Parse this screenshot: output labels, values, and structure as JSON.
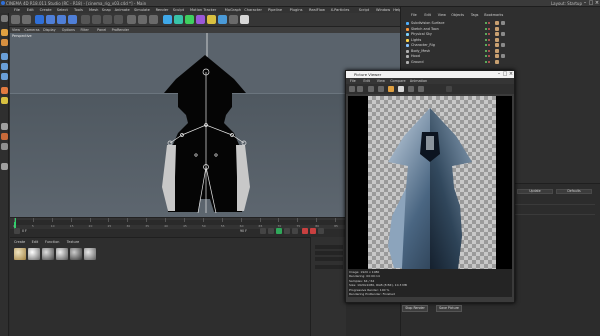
{
  "window": {
    "title": "CINEMA 4D R18.011 Studio (RC - R18) - [cinema_rig_v03.c4d *] - Main",
    "right_text": "Layout: Startup",
    "controls": [
      "–",
      "□",
      "×"
    ]
  },
  "menubar": {
    "items": [
      "File",
      "Edit",
      "Create",
      "Select",
      "Tools",
      "Mesh",
      "Snap",
      "Animate",
      "Simulate",
      "Render",
      "Sculpt",
      "Motion Tracker",
      "MoGraph",
      "Character",
      "Pipeline",
      "Plugins",
      "RealFlow",
      "X-Particles",
      "Script",
      "Window",
      "Help"
    ]
  },
  "viewport": {
    "menu": [
      "View",
      "Cameras",
      "Display",
      "Options",
      "Filter",
      "Panel",
      "ProRender"
    ],
    "label": "Perspective"
  },
  "timeline": {
    "frames": [
      "0",
      "5",
      "10",
      "15",
      "20",
      "25",
      "30",
      "35",
      "40",
      "45",
      "50",
      "55",
      "60",
      "65",
      "70",
      "75",
      "80",
      "85",
      "90"
    ],
    "current_frame": "0 F",
    "end_frame": "90 F"
  },
  "materials": {
    "menu": [
      "Create",
      "Edit",
      "Function",
      "Texture"
    ],
    "count": 6
  },
  "objects": {
    "menu": [
      "File",
      "Edit",
      "View",
      "Objects",
      "Tags",
      "Bookmarks"
    ],
    "rows": [
      {
        "name": "Subdivision Surface",
        "icon_color": "#4fb0ff"
      },
      {
        "name": "Sketch and Toon",
        "icon_color": "#ff9a3c"
      },
      {
        "name": "Physical Sky",
        "icon_color": "#7ad1ff"
      },
      {
        "name": "Lights",
        "icon_color": "#ffd54a"
      },
      {
        "name": "Character_Rig",
        "icon_color": "#8ac4ff"
      },
      {
        "name": "Body_Mesh",
        "icon_color": "#b0b0b0"
      },
      {
        "name": "Hood",
        "icon_color": "#b0b0b0"
      },
      {
        "name": "Ground",
        "icon_color": "#b0b0b0"
      }
    ]
  },
  "attributes": {
    "buttons": [
      "Mode",
      "Edit",
      "User Data"
    ],
    "action_buttons": [
      "Update",
      "Defaults"
    ]
  },
  "picture_viewer": {
    "title": "Picture Viewer",
    "menu": [
      "File",
      "Edit",
      "View",
      "Compare",
      "Animation"
    ],
    "status_lines": [
      "Image: 1920 x 1080",
      "Rendering: 00:00:14",
      "Samples: 64 / 64",
      "Size: 1920x1080, RGB (8 Bit), 10.3 MB",
      "Progressive Render: 100 %",
      "Rendering ProRender: Finished"
    ],
    "buttons": [
      "Stop Render",
      "Save Picture"
    ]
  },
  "colors": {
    "accent": "#2fd06a",
    "viewport_bg": "#5a636c",
    "panel_bg": "#2f2f2f",
    "selection_blue": "#2f6fd8"
  }
}
